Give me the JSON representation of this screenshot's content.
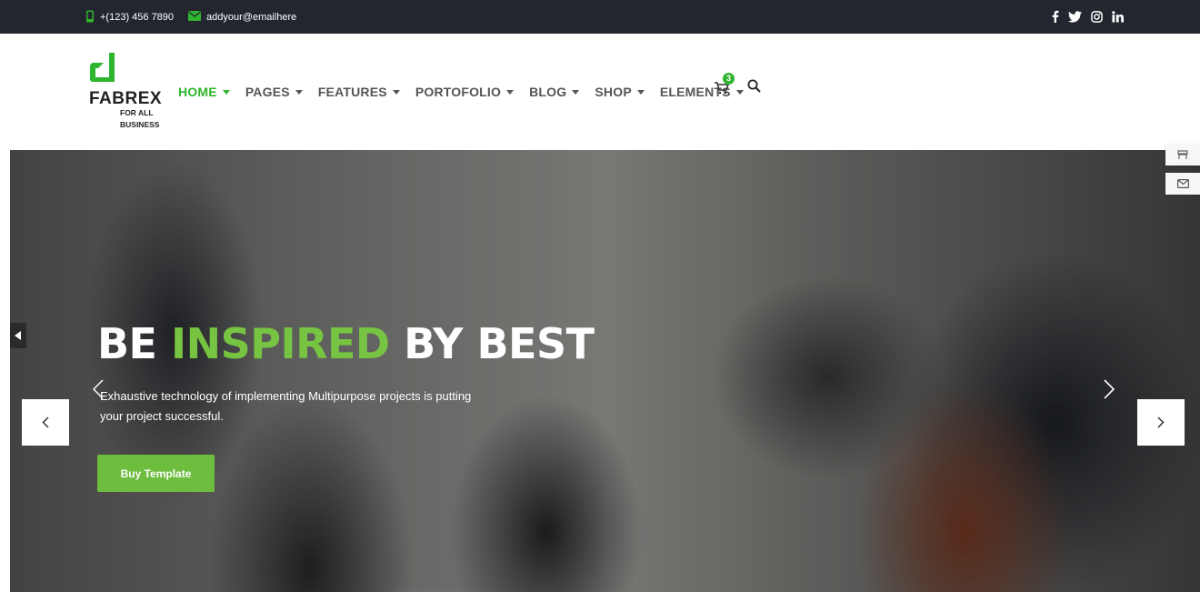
{
  "topbar": {
    "phone": "+(123) 456 7890",
    "email": "addyour@emailhere",
    "social": [
      {
        "icon": "facebook-icon",
        "label": "f"
      },
      {
        "icon": "twitter-icon",
        "label": "t"
      },
      {
        "icon": "instagram-icon",
        "label": "ig"
      },
      {
        "icon": "linkedin-icon",
        "label": "in"
      }
    ]
  },
  "logo": {
    "name": "FABREX",
    "tagline": "FOR ALL BUSINESS"
  },
  "nav": {
    "items": [
      {
        "label": "HOME",
        "active": true
      },
      {
        "label": "PAGES"
      },
      {
        "label": "FEATURES"
      },
      {
        "label": "PORTOFOLIO"
      },
      {
        "label": "BLOG"
      },
      {
        "label": "SHOP"
      },
      {
        "label": "ELEMENTS"
      }
    ],
    "cart_count": "3"
  },
  "hero": {
    "title_pre": "BE ",
    "title_highlight": "INSPIRED",
    "title_post": " BY BEST",
    "description": "Exhaustive technology of implementing Multipurpose projects is putting your project successful.",
    "button": "Buy Template"
  },
  "colors": {
    "accent": "#2fb52f",
    "button": "#6fbd3e",
    "topbar": "#23262e"
  }
}
